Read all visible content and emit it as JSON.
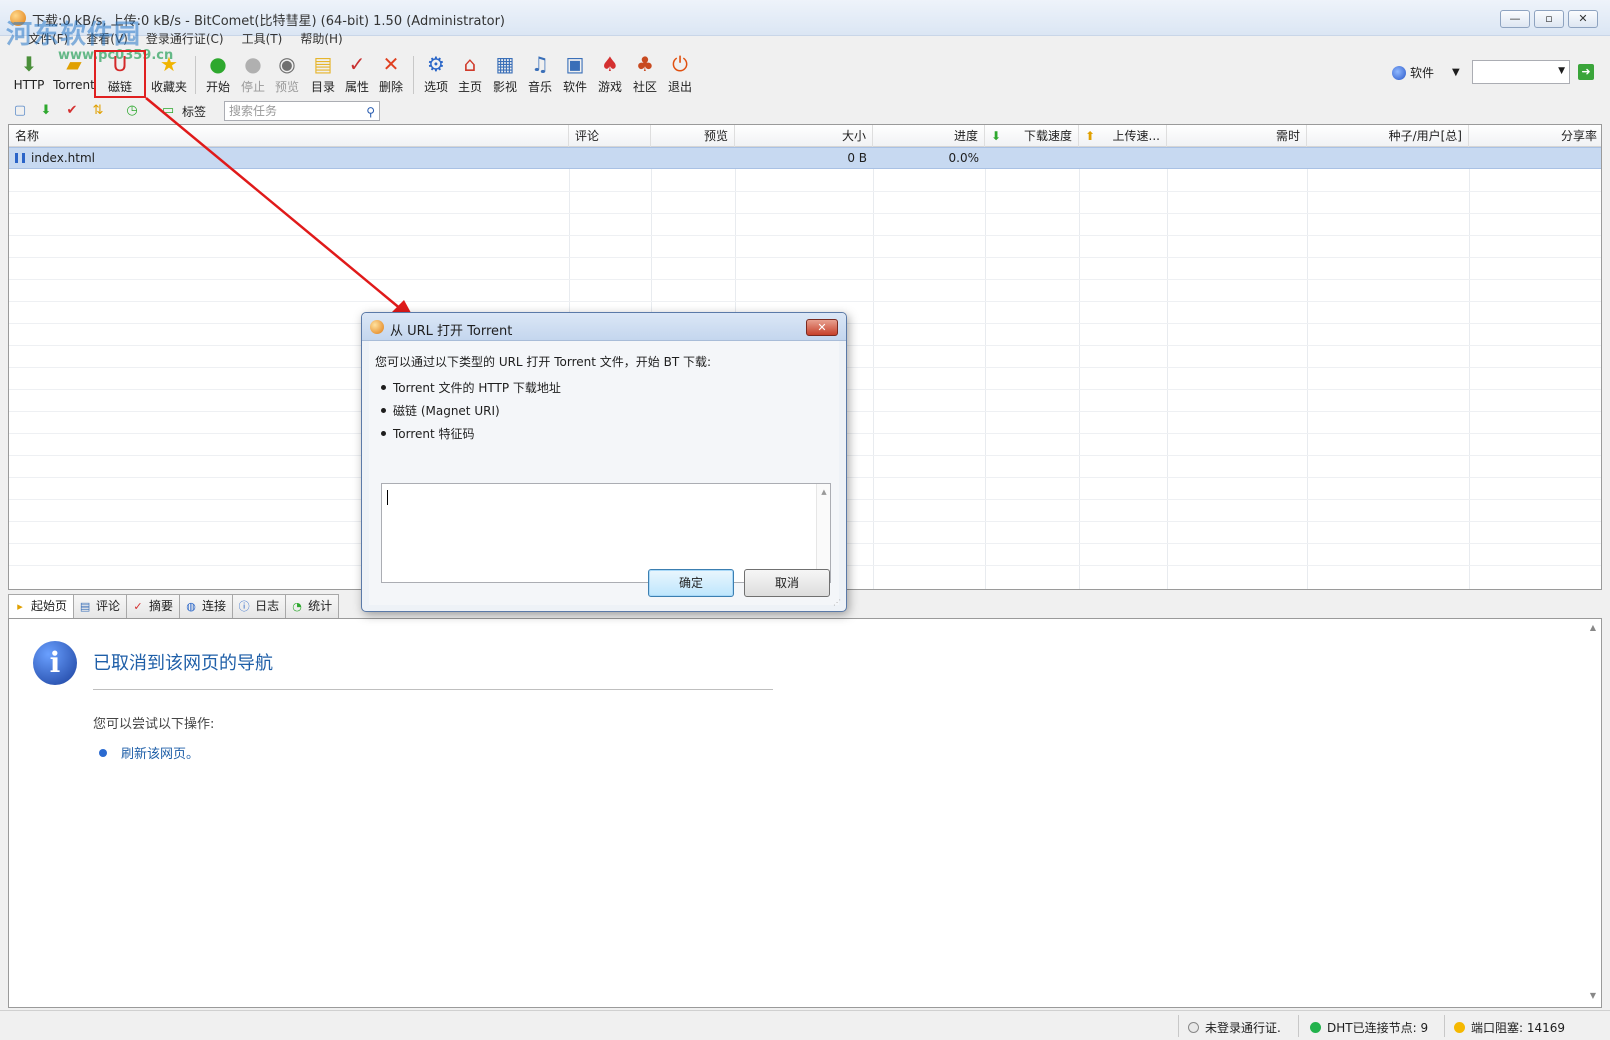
{
  "window": {
    "title": "下载:0 kB/s, 上传:0 kB/s - BitComet(比特彗星) (64-bit) 1.50 (Administrator)",
    "minimize": "—",
    "maximize": "▫",
    "close": "✕"
  },
  "watermark": {
    "text": "河东软件园",
    "url": "www.pc0359.cn"
  },
  "menu": [
    "文件(F)",
    "查看(V)",
    "登录通行证(C)",
    "工具(T)",
    "帮助(H)"
  ],
  "toolbar": {
    "http": "HTTP",
    "torrent": "Torrent",
    "magnet": "磁链",
    "favorites": "收藏夹",
    "start": "开始",
    "stop": "停止",
    "preview": "预览",
    "folder": "目录",
    "properties": "属性",
    "delete": "删除",
    "options": "选项",
    "home": "主页",
    "video": "影视",
    "music": "音乐",
    "software": "软件",
    "games": "游戏",
    "community": "社区",
    "exit": "退出",
    "right_label": "软件",
    "combo_value": ""
  },
  "subbar": {
    "tag_label": "标签",
    "search_placeholder": "搜索任务"
  },
  "task_list": {
    "columns": [
      "名称",
      "评论",
      "预览",
      "大小",
      "进度",
      "下载速度",
      "上传速...",
      "需时",
      "种子/用户[总]",
      "分享率"
    ],
    "rows": [
      {
        "name": "index.html",
        "comment": "",
        "preview": "",
        "size": "0 B",
        "progress": "0.0%",
        "down": "",
        "up": "",
        "eta": "",
        "seeds": "",
        "ratio": ""
      }
    ]
  },
  "tabs": [
    "起始页",
    "评论",
    "摘要",
    "连接",
    "日志",
    "统计"
  ],
  "webpage": {
    "title": "已取消到该网页的导航",
    "hint": "您可以尝试以下操作:",
    "link": "刷新该网页。"
  },
  "status": {
    "login": "未登录通行证.",
    "dht": "DHT已连接节点: 9",
    "port": "端口阻塞: 14169",
    "colors": {
      "dht": "#22b24c",
      "port": "#f5b800"
    }
  },
  "dialog": {
    "title": "从 URL 打开 Torrent",
    "intro": "您可以通过以下类型的 URL 打开 Torrent 文件，开始 BT 下载:",
    "items": [
      "Torrent 文件的 HTTP 下载地址",
      "磁链 (Magnet URI)",
      "Torrent 特征码"
    ],
    "input_value": "",
    "ok": "确定",
    "cancel": "取消"
  }
}
